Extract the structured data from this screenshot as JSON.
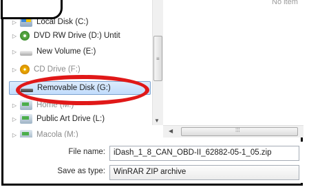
{
  "dialog": {
    "empty_message": "No item"
  },
  "nav_items": [
    {
      "label": "Local Disk (C:)",
      "icon": "local-disk-icon"
    },
    {
      "label": "DVD RW Drive (D:) Untit",
      "icon": "dvd-drive-icon"
    },
    {
      "label": "New Volume (E:)",
      "icon": "drive-icon"
    },
    {
      "label": "CD Drive (F:)",
      "icon": "cd-drive-icon"
    },
    {
      "label": "Removable Disk (G:)",
      "icon": "removable-disk-icon",
      "selected": true
    },
    {
      "label": "Home (M:)",
      "icon": "network-drive-icon"
    },
    {
      "label": "Public Art Drive (L:)",
      "icon": "network-drive-icon"
    },
    {
      "label": "Macola (M:)",
      "icon": "network-drive-icon"
    }
  ],
  "form": {
    "file_name_label": "File name:",
    "file_name_value": "iDash_1_8_CAN_OBD-II_62882-05-1_05.zip",
    "save_as_type_label": "Save as type:",
    "save_as_type_value": "WinRAR ZIP archive"
  },
  "colors": {
    "highlight": "#e01818",
    "selection_bg": "#c1dcfc"
  }
}
